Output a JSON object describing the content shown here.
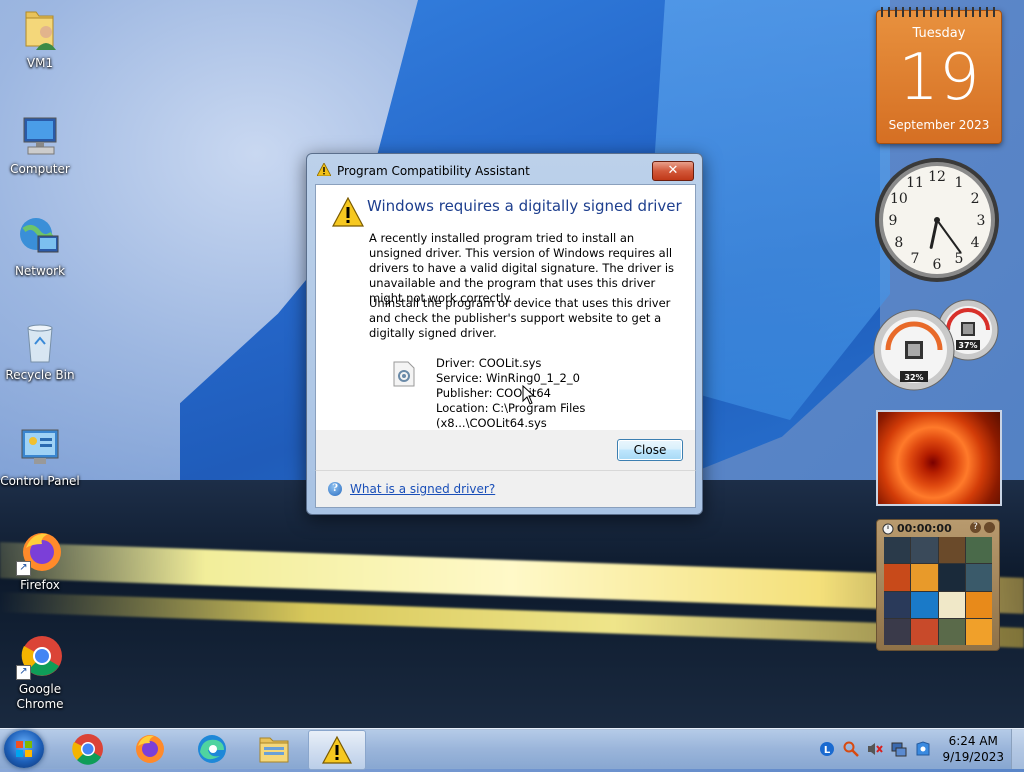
{
  "desktop": {
    "icons": [
      {
        "label": "VM1"
      },
      {
        "label": "Computer"
      },
      {
        "label": "Network"
      },
      {
        "label": "Recycle Bin"
      },
      {
        "label": "Control Panel"
      },
      {
        "label": "Firefox"
      },
      {
        "label": "Google Chrome"
      }
    ]
  },
  "dialog": {
    "title": "Program Compatibility Assistant",
    "close_glyph": "✕",
    "heading": "Windows requires a digitally signed driver",
    "paragraph1": "A recently installed program tried to install an unsigned driver. This version of Windows requires all drivers to have a valid digital signature. The driver is unavailable and the program that uses this driver might not work correctly.",
    "paragraph2": "Uninstall the program or device that uses this driver and check the publisher's support website to get a digitally signed driver.",
    "details": {
      "driver": "Driver: COOLit.sys",
      "service": "Service: WinRing0_1_2_0",
      "publisher": "Publisher: COOLit64",
      "location": "Location: C:\\Program Files (x8...\\COOLit64.sys"
    },
    "close_button": "Close",
    "help_glyph": "?",
    "help_link": "What is a signed driver?"
  },
  "gadgets": {
    "calendar": {
      "day": "Tuesday",
      "date": "19",
      "month_year": "September 2023"
    },
    "clock": {
      "numbers": [
        "12",
        "1",
        "2",
        "3",
        "4",
        "5",
        "6",
        "7",
        "8",
        "9",
        "10",
        "11"
      ],
      "hour": 6,
      "minute": 24
    },
    "meter": {
      "cpu": "32%",
      "memory": "37%"
    },
    "puzzle": {
      "time": "00:00:00",
      "help_glyph": "?"
    }
  },
  "taskbar": {
    "items": [
      "start",
      "chrome",
      "firefox",
      "edge",
      "file-explorer",
      "program-compatibility-assistant"
    ],
    "time": "6:24 AM",
    "date": "9/19/2023"
  },
  "colors": {
    "accent_heading": "#1e3f8e",
    "link": "#1a4fb8",
    "calendar_orange": "#d56f23",
    "close_red": "#c03818"
  }
}
